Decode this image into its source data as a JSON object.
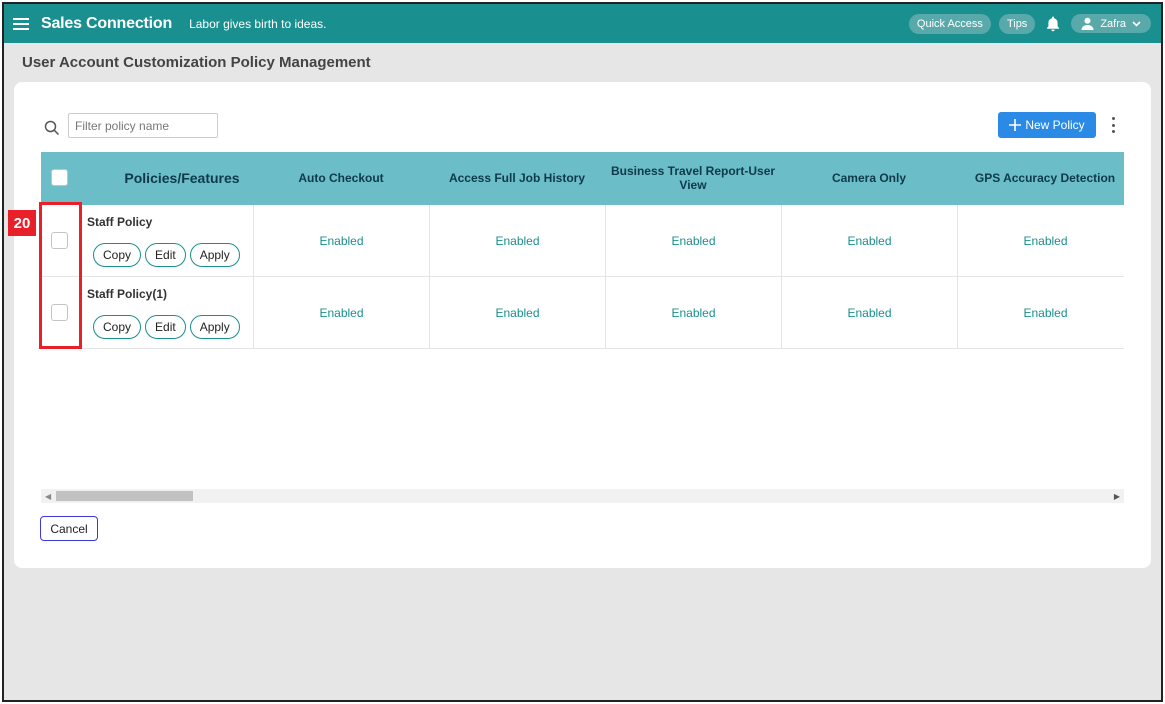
{
  "topbar": {
    "brand": "Sales Connection",
    "tagline": "Labor gives birth to ideas.",
    "quick_access": "Quick Access",
    "tips": "Tips",
    "user_name": "Zafra",
    "accent": "#1a8f8f"
  },
  "page": {
    "title": "User Account Customization Policy Management"
  },
  "toolbar": {
    "filter_placeholder": "Filter policy name",
    "new_policy_label": "New Policy"
  },
  "table": {
    "headers": [
      "Policies/Features",
      "Auto Checkout",
      "Access Full Job History",
      "Business Travel Report-User View",
      "Camera Only",
      "GPS Accuracy Detection"
    ],
    "rows": [
      {
        "name": "Staff Policy",
        "values": [
          "Enabled",
          "Enabled",
          "Enabled",
          "Enabled",
          "Enabled"
        ]
      },
      {
        "name": "Staff Policy(1)",
        "values": [
          "Enabled",
          "Enabled",
          "Enabled",
          "Enabled",
          "Enabled"
        ]
      }
    ],
    "action_labels": {
      "copy": "Copy",
      "edit": "Edit",
      "apply": "Apply"
    }
  },
  "footer": {
    "cancel_label": "Cancel"
  },
  "annotation": {
    "badge": "20",
    "color": "#e8202a"
  }
}
